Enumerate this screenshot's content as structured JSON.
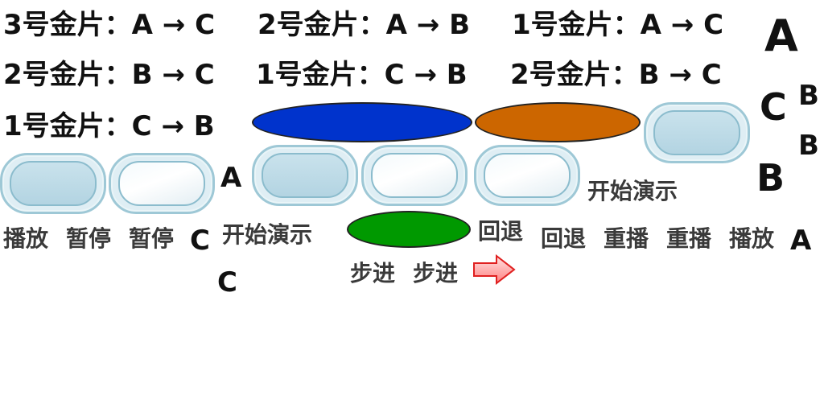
{
  "moves": [
    "3号金片：A → C",
    "2号金片：A → B",
    "1号金片：A → C",
    "2号金片：B → C",
    "1号金片：C → B",
    "2号金片：B → C",
    "1号金片：C → B"
  ],
  "pegs": {
    "top_a": "A",
    "top_c": "C",
    "top_b1": "B",
    "top_b2": "B",
    "top_b3": "B",
    "mid_a": "A",
    "mid_c": "C",
    "low_c": "C",
    "right_a": "A"
  },
  "buttons": {
    "play_1": "播放",
    "pause_1": "暂停",
    "pause_2": "暂停",
    "start_1": "开始演示",
    "start_2": "开始演示",
    "step_1": "步进",
    "step_2": "步进",
    "back_1": "回退",
    "back_2": "回退",
    "replay_1": "重播",
    "replay_2": "重播",
    "play_2": "播放"
  },
  "icons": {
    "next": "arrow-right-icon"
  },
  "colors": {
    "disk_large": "#0033cc",
    "disk_medium": "#cc6600",
    "disk_small": "#009900",
    "button_border": "#9ec8d6",
    "arrow": "#ff8080"
  }
}
